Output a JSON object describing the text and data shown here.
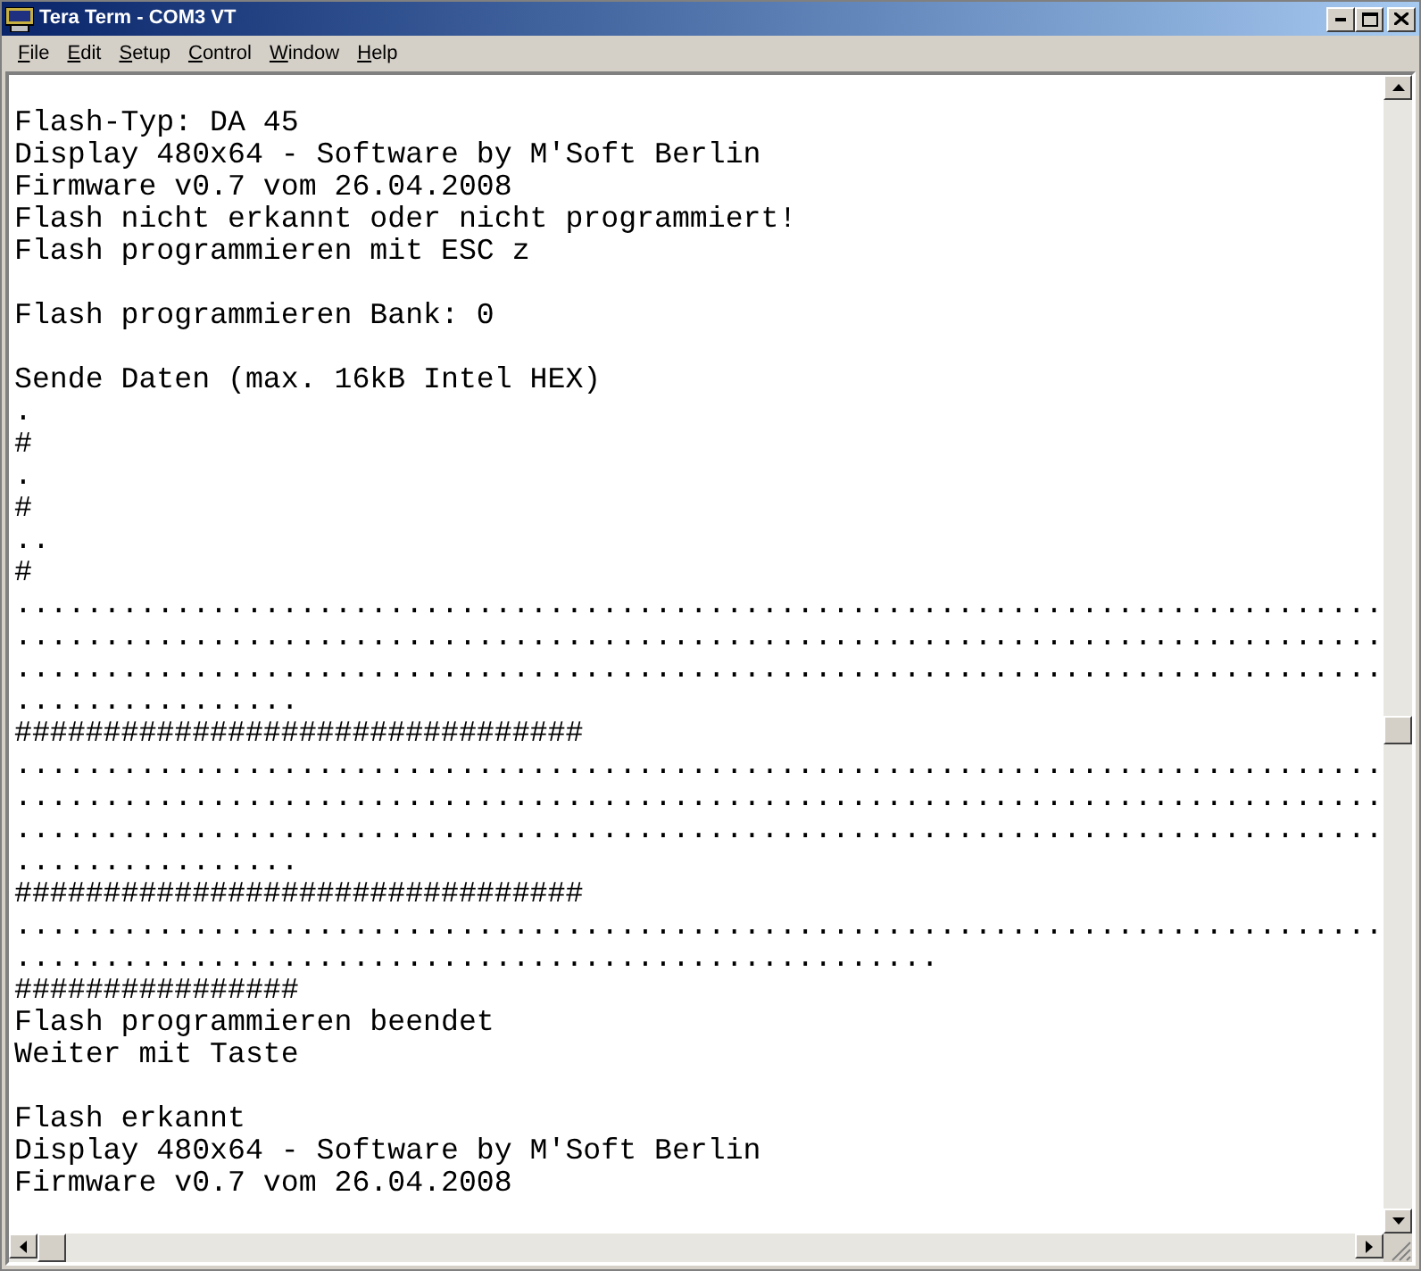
{
  "window": {
    "title": "Tera Term - COM3 VT"
  },
  "menu": [
    {
      "label": "File"
    },
    {
      "label": "Edit"
    },
    {
      "label": "Setup"
    },
    {
      "label": "Control"
    },
    {
      "label": "Window"
    },
    {
      "label": "Help"
    }
  ],
  "terminal": {
    "lines": [
      {
        "kind": "blank"
      },
      {
        "kind": "text",
        "text": "Flash-Typ: DA 45"
      },
      {
        "kind": "text",
        "text": "Display 480x64 - Software by M'Soft Berlin"
      },
      {
        "kind": "text",
        "text": "Firmware v0.7 vom 26.04.2008"
      },
      {
        "kind": "text",
        "text": "Flash nicht erkannt oder nicht programmiert!"
      },
      {
        "kind": "text",
        "text": "Flash programmieren mit ESC z"
      },
      {
        "kind": "blank"
      },
      {
        "kind": "text",
        "text": "Flash programmieren Bank: 0"
      },
      {
        "kind": "blank"
      },
      {
        "kind": "text",
        "text": "Sende Daten (max. 16kB Intel HEX)"
      },
      {
        "kind": "text",
        "text": "."
      },
      {
        "kind": "text",
        "text": "#"
      },
      {
        "kind": "text",
        "text": "."
      },
      {
        "kind": "text",
        "text": "#"
      },
      {
        "kind": "text",
        "text": ".."
      },
      {
        "kind": "text",
        "text": "#"
      },
      {
        "kind": "text",
        "text": "............................................................................."
      },
      {
        "kind": "text",
        "text": "............................................................................."
      },
      {
        "kind": "text",
        "text": "............................................................................."
      },
      {
        "kind": "text",
        "text": "................"
      },
      {
        "kind": "text",
        "text": "################################"
      },
      {
        "kind": "text",
        "text": "............................................................................."
      },
      {
        "kind": "text",
        "text": "............................................................................."
      },
      {
        "kind": "text",
        "text": "............................................................................."
      },
      {
        "kind": "text",
        "text": "................"
      },
      {
        "kind": "text",
        "text": "################################"
      },
      {
        "kind": "text",
        "text": "............................................................................."
      },
      {
        "kind": "text",
        "text": "...................................................."
      },
      {
        "kind": "text",
        "text": "################"
      },
      {
        "kind": "text",
        "text": "Flash programmieren beendet"
      },
      {
        "kind": "text",
        "text": "Weiter mit Taste"
      },
      {
        "kind": "blank"
      },
      {
        "kind": "text",
        "text": "Flash erkannt"
      },
      {
        "kind": "text",
        "text": "Display 480x64 - Software by M'Soft Berlin"
      },
      {
        "kind": "text",
        "text": "Firmware v0.7 vom 26.04.2008"
      }
    ]
  }
}
